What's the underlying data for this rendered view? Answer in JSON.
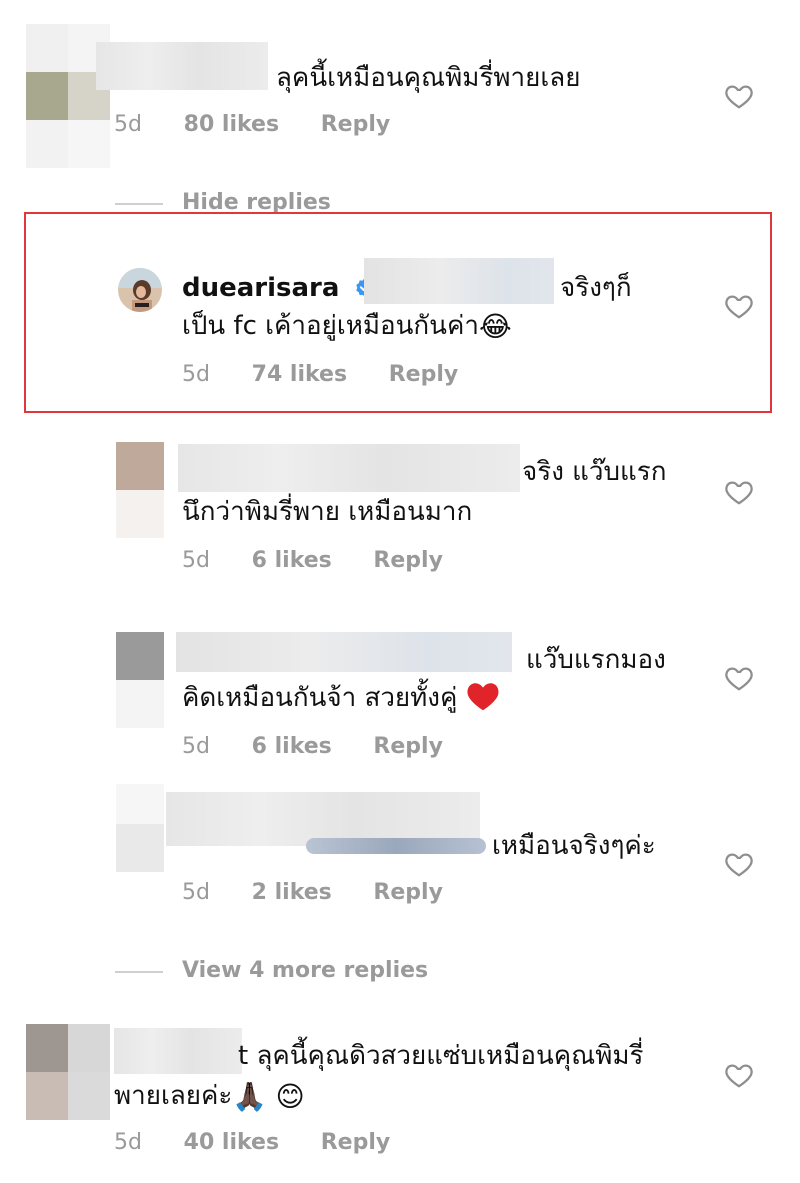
{
  "colors": {
    "highlight_border": "#e0383a",
    "verified": "#3897f0",
    "heart_red": "#e0242a"
  },
  "comments": [
    {
      "text1": "ลุคนี้เหมือนคุณพิมรี่พายเลย",
      "age": "5d",
      "likes": "80 likes",
      "reply": "Reply"
    },
    {
      "username": "duearisara",
      "text1": "จริงๆก็",
      "text2": "เป็น fc เค้าอยู่เหมือนกันค่า",
      "emoji": "😂",
      "age": "5d",
      "likes": "74 likes",
      "reply": "Reply"
    },
    {
      "text1": "จริง แว๊บแรก",
      "text2": "นึกว่าพิมรี่พาย เหมือนมาก",
      "age": "5d",
      "likes": "6 likes",
      "reply": "Reply"
    },
    {
      "text1": "แว๊บแรกมอง",
      "text2": "คิดเหมือนกันจ้า สวยทั้งคู่",
      "age": "5d",
      "likes": "6 likes",
      "reply": "Reply"
    },
    {
      "text1": "เหมือนจริงๆค่ะ",
      "age": "5d",
      "likes": "2 likes",
      "reply": "Reply"
    },
    {
      "text1": "t ลุคนี้คุณดิวสวยแซ่บเหมือนคุณพิมรี่",
      "text2": "พายเลยค่ะ",
      "emoji2": "🙏🏿",
      "emoji3": "😊",
      "age": "5d",
      "likes": "40 likes",
      "reply": "Reply"
    }
  ],
  "toggles": {
    "hide_replies": "Hide replies",
    "view_more": "View 4 more replies"
  },
  "icons": {
    "like": "heart-outline-icon",
    "verified": "verified-badge-icon"
  }
}
